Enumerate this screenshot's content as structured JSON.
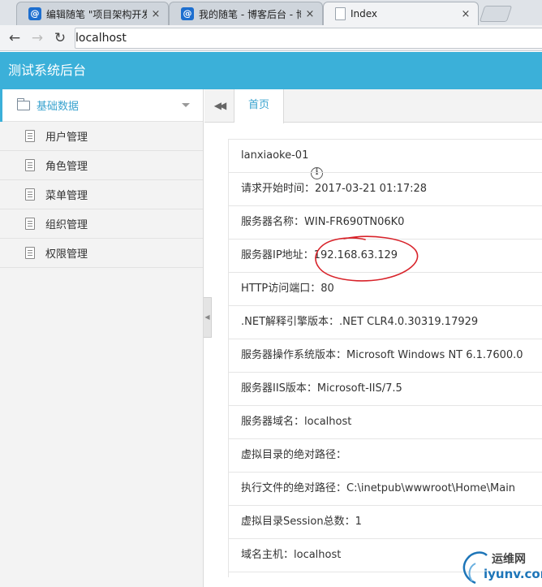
{
  "browser": {
    "tabs": [
      {
        "title": "编辑随笔 \"项目架构开发",
        "icon": "blog-favicon-icon",
        "active": false
      },
      {
        "title": "我的随笔 - 博客后台 - 博",
        "icon": "blog-favicon-icon",
        "active": false
      },
      {
        "title": "Index",
        "icon": "page-icon",
        "active": true
      }
    ],
    "close_glyph": "×",
    "back_glyph": "←",
    "forward_glyph": "→",
    "reload_glyph": "↻",
    "info_glyph": "i",
    "url": "localhost"
  },
  "app": {
    "title": "测试系统后台"
  },
  "sidebar": {
    "group_label": "基础数据",
    "items": [
      {
        "label": "用户管理"
      },
      {
        "label": "角色管理"
      },
      {
        "label": "菜单管理"
      },
      {
        "label": "组织管理"
      },
      {
        "label": "权限管理"
      }
    ],
    "collapse_glyph": "◀"
  },
  "content": {
    "scroll_left_glyph": "◀◀",
    "home_tab": "首页",
    "rows": [
      "lanxiaoke-01",
      "请求开始时间：2017-03-21 01:17:28",
      "服务器名称：WIN-FR690TN06K0",
      "服务器IP地址：192.168.63.129",
      "HTTP访问端口：80",
      ".NET解释引擎版本：.NET CLR4.0.30319.17929",
      "服务器操作系统版本：Microsoft Windows NT 6.1.7600.0",
      "服务器IIS版本：Microsoft-IIS/7.5",
      "服务器域名：localhost",
      "虚拟目录的绝对路径：",
      "执行文件的绝对路径：C:\\inetpub\\wwwroot\\Home\\Main",
      "虚拟目录Session总数：1",
      "域名主机：localhost"
    ]
  },
  "watermark": {
    "cn": "运维网",
    "en": "iyunv.com"
  },
  "colors": {
    "accent": "#3bb0d9",
    "annotation": "#d8232a"
  }
}
